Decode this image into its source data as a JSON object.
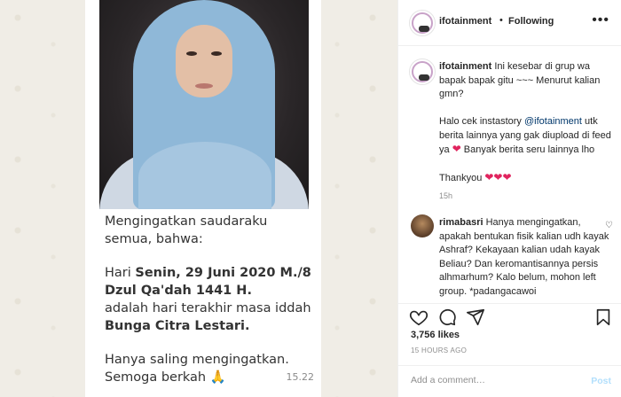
{
  "post": {
    "account": "ifotainment",
    "separator": "•",
    "follow_status": "Following",
    "more_icon": "•••"
  },
  "media": {
    "message_line1": "Mengingatkan saudaraku semua, bahwa:",
    "message_hari": "Hari ",
    "message_date_bold": "Senin, 29 Juni 2020 M./8 Dzul Qa'dah 1441 H.",
    "message_line3": "adalah hari terakhir masa iddah",
    "message_name_bold": "Bunga Citra Lestari.",
    "message_line5": "Hanya saling mengingatkan.",
    "message_line6": "Semoga berkah",
    "message_emoji": "🙏",
    "message_time": "15.22"
  },
  "caption": {
    "username": "ifotainment",
    "text1": " Ini kesebar di grup wa bapak bapak gitu ~~~ Menurut kalian gmn?",
    "text2_prefix": "Halo cek instastory ",
    "text2_mention": "@ifotainment",
    "text2_suffix": " utk berita lainnya yang gak diupload di feed ya ",
    "text2_heart": "❤",
    "text2_end": " Banyak berita seru lainnya lho",
    "text3": "Thankyou ",
    "text3_hearts": "❤❤❤",
    "time": "15h"
  },
  "comment": {
    "username": "rimabasri",
    "text": " Hanya mengingatkan, apakah bentukan fisik kalian udh kayak Ashraf? Kekayaan kalian udah kayak Beliau? Dan keromantisannya persis alhmarhum? Kalo belum, mohon left group. *padangacawoi",
    "like_icon": "♡"
  },
  "stats": {
    "likes": "3,756 likes",
    "time_ago": "15 HOURS AGO"
  },
  "add_comment": {
    "placeholder": "Add a comment…",
    "post_label": "Post"
  },
  "colors": {
    "hijab": "#8fb8d8",
    "heart": "#e0245e",
    "mention": "#00376b",
    "post_button": "#b2dffc"
  }
}
